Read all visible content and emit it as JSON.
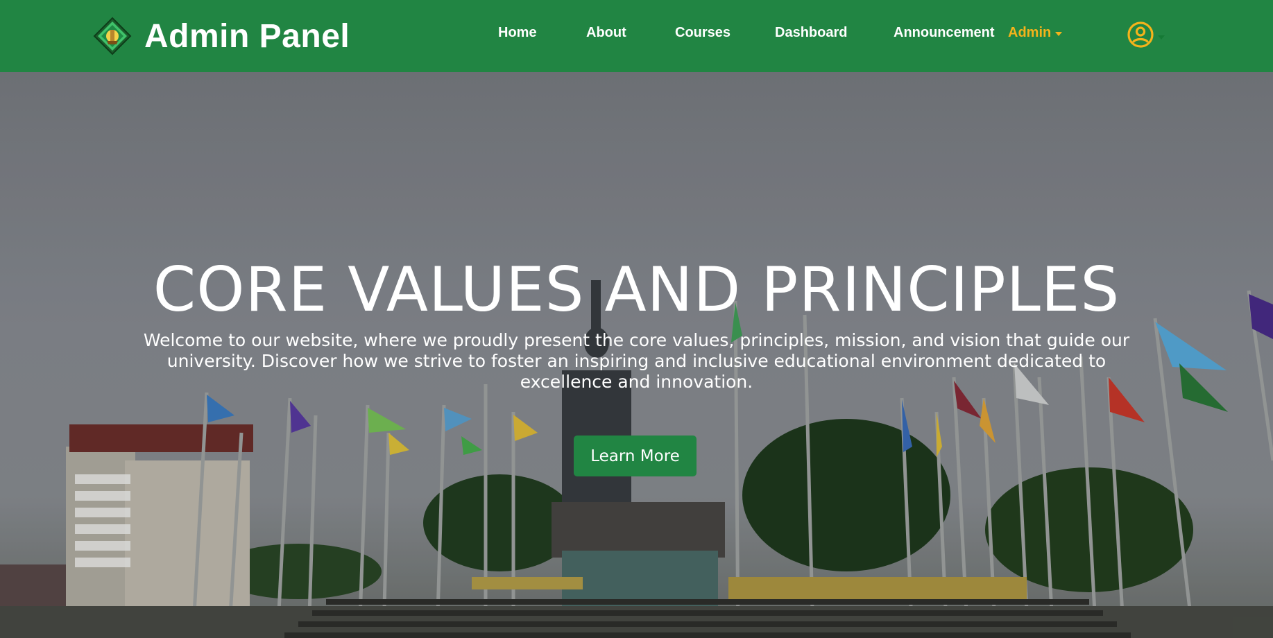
{
  "navbar": {
    "brand_title": "Admin Panel",
    "links": [
      {
        "label": "Home"
      },
      {
        "label": "About"
      },
      {
        "label": "Courses"
      },
      {
        "label": "Dashboard"
      },
      {
        "label": "Announcement"
      }
    ],
    "admin_label": "Admin",
    "user_icon": "user-circle-icon",
    "brand_color": "#218543",
    "accent_color": "#f5b31b"
  },
  "hero": {
    "title": "CORE VALUES AND PRINCIPLES",
    "description": "Welcome to our website, where we proudly present the core values, principles, mission, and vision that guide our university. Discover how we strive to foster an inspiring and inclusive educational environment dedicated to excellence and innovation.",
    "button_label": "Learn More"
  }
}
